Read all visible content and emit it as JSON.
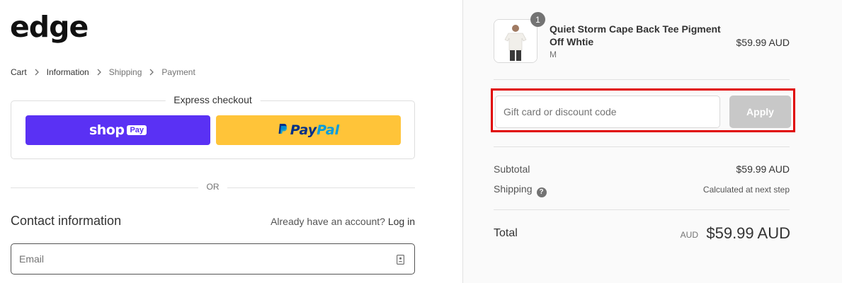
{
  "brand": {
    "logo_text": "edge"
  },
  "breadcrumb": {
    "items": [
      "Cart",
      "Information",
      "Shipping",
      "Payment"
    ]
  },
  "express": {
    "title": "Express checkout",
    "shop_pay": {
      "shop": "shop",
      "pay": "Pay",
      "color": "#5a31f4"
    },
    "paypal": {
      "pay": "Pay",
      "pal": "Pal",
      "color": "#ffc439"
    }
  },
  "divider_text": "OR",
  "contact": {
    "title": "Contact information",
    "account_prompt": "Already have an account?",
    "login_label": "Log in",
    "email_placeholder": "Email"
  },
  "order": {
    "product": {
      "name": "Quiet Storm Cape Back Tee Pigment Off Whtie",
      "variant": "M",
      "price": "$59.99 AUD",
      "quantity": "1"
    },
    "discount": {
      "placeholder": "Gift card or discount code",
      "apply_label": "Apply",
      "highlight_color": "#e00000"
    },
    "subtotal": {
      "label": "Subtotal",
      "value": "$59.99 AUD"
    },
    "shipping": {
      "label": "Shipping",
      "value": "Calculated at next step"
    },
    "total": {
      "label": "Total",
      "currency": "AUD",
      "value": "$59.99 AUD"
    }
  }
}
